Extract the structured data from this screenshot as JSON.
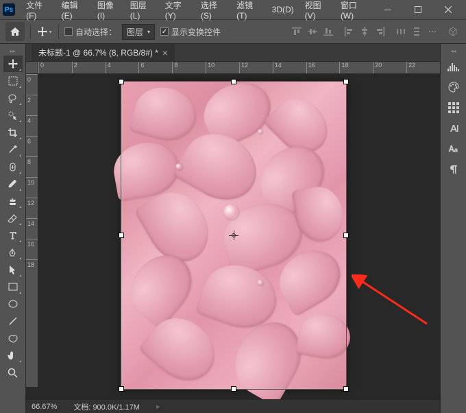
{
  "app": {
    "name": "Ps"
  },
  "menu": {
    "file": "文件(F)",
    "edit": "编辑(E)",
    "image": "图像(I)",
    "layer": "图层(L)",
    "type": "文字(Y)",
    "select": "选择(S)",
    "filter": "滤镜(T)",
    "three_d": "3D(D)",
    "view": "视图(V)",
    "window": "窗口(W)"
  },
  "options": {
    "auto_select_label": "自动选择：",
    "dropdown_value": "图层",
    "show_transform_label": "显示变换控件"
  },
  "tab": {
    "title": "未标题-1 @ 66.7% (8, RGB/8#) *"
  },
  "ruler_h": [
    "0",
    "2",
    "4",
    "6",
    "8",
    "10",
    "12",
    "14",
    "16",
    "18",
    "20",
    "22"
  ],
  "ruler_v": [
    "0",
    "2",
    "4",
    "6",
    "8",
    "10",
    "12",
    "14",
    "16",
    "18"
  ],
  "status": {
    "zoom": "66.67%",
    "doc_label": "文档:",
    "doc_value": "900.0K/1.17M"
  },
  "colors": {
    "accent": "#31a8ff",
    "arrow": "#ff2a1a"
  }
}
